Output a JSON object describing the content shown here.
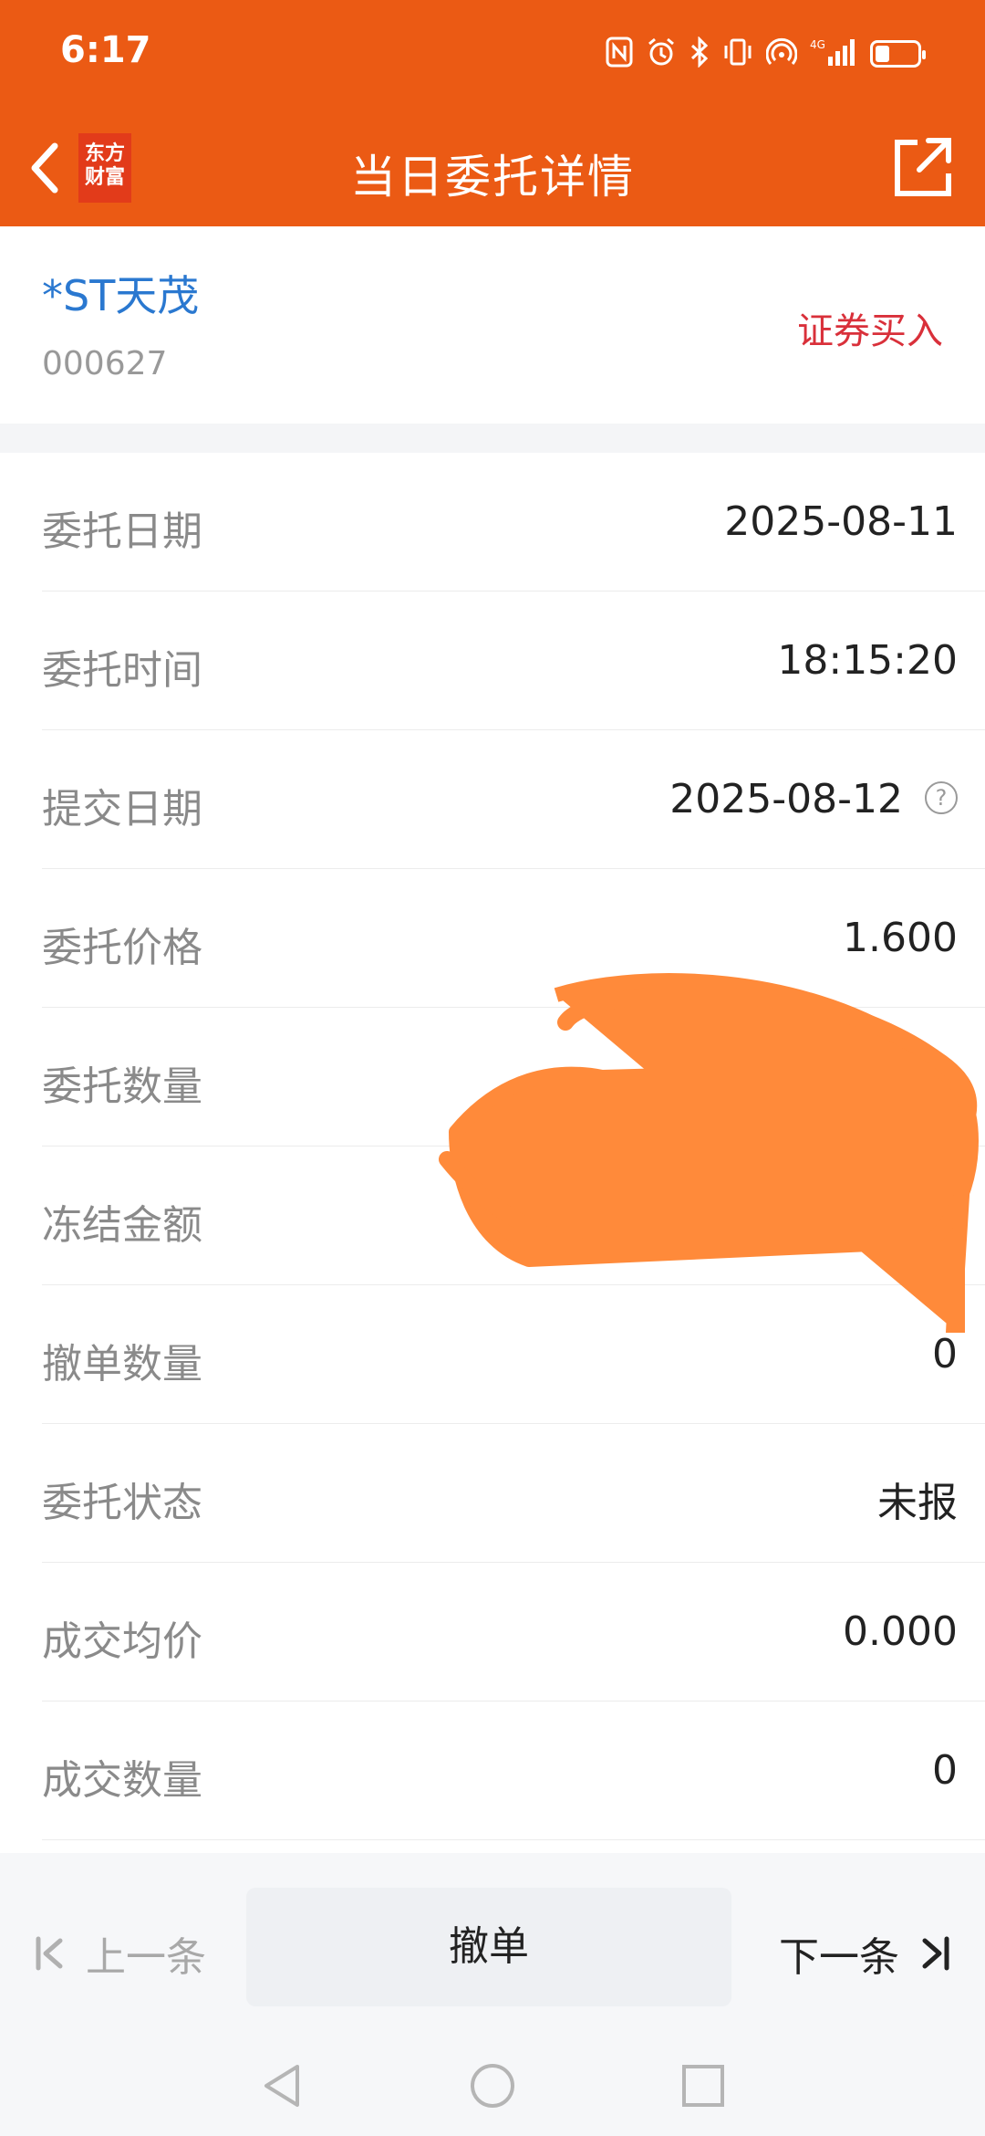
{
  "status_bar": {
    "time": "6:17",
    "icons": [
      "nfc-icon",
      "alarm-icon",
      "bluetooth-icon",
      "vibrate-icon",
      "hotspot-icon",
      "signal-4g-icon",
      "battery-icon"
    ],
    "network_label": "4G",
    "battery_level": 0.35
  },
  "nav": {
    "title": "当日委托详情",
    "logo_text_1": "东方",
    "logo_text_2": "财富"
  },
  "stock": {
    "name": "*ST天茂",
    "code": "000627",
    "trade_type": "证券买入"
  },
  "details": [
    {
      "label": "委托日期",
      "value": "2025-08-11"
    },
    {
      "label": "委托时间",
      "value": "18:15:20"
    },
    {
      "label": "提交日期",
      "value": "2025-08-12"
    },
    {
      "label": "委托价格",
      "value": "1.600"
    },
    {
      "label": "委托数量",
      "value": ""
    },
    {
      "label": "冻结金额",
      "value": ""
    },
    {
      "label": "撤单数量",
      "value": "0"
    },
    {
      "label": "委托状态",
      "value": "未报"
    },
    {
      "label": "成交均价",
      "value": "0.000"
    },
    {
      "label": "成交数量",
      "value": "0"
    }
  ],
  "bottom": {
    "prev_label": "上一条",
    "cancel_label": "撤单",
    "next_label": "下一条"
  },
  "colors": {
    "brand": "#EB5A14",
    "stock_name": "#2A78D0",
    "trade_type": "#D9303A",
    "redaction": "#FF8A3A"
  }
}
